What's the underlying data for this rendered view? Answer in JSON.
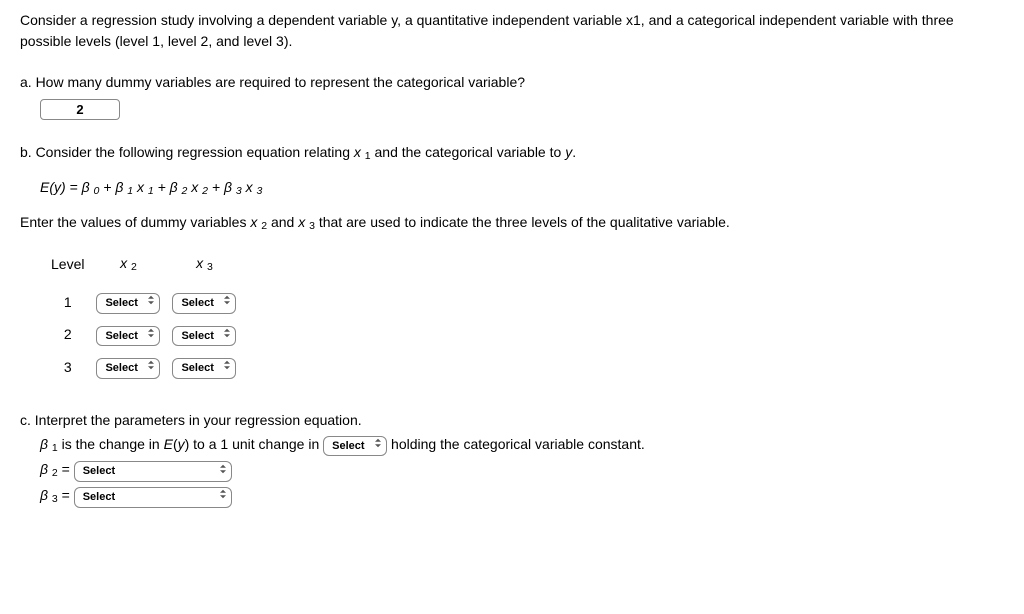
{
  "intro": "Consider a regression study involving a dependent variable y, a quantitative independent variable x1, and a categorical independent variable with three possible levels (level 1, level 2, and level 3).",
  "a": {
    "prompt": "a. How many dummy variables are required to represent the categorical variable?",
    "value": "2"
  },
  "b": {
    "prompt1": "b. Consider the following regression equation relating x ₁ and the categorical variable to y.",
    "equation": "E(y) = β ₀ + β ₁ x ₁ + β ₂ x ₂ + β ₃ x ₃",
    "prompt2": "Enter the values of dummy variables x ₂ and x ₃ that are used to indicate the three levels of the qualitative variable.",
    "headers": {
      "level": "Level",
      "x2": "x 2",
      "x3": "x 3"
    },
    "rows": [
      {
        "level": "1",
        "x2": "Select",
        "x3": "Select"
      },
      {
        "level": "2",
        "x2": "Select",
        "x3": "Select"
      },
      {
        "level": "3",
        "x2": "Select",
        "x3": "Select"
      }
    ]
  },
  "c": {
    "prompt": "c. Interpret the parameters in your regression equation.",
    "b1_pre": "β ₁ is the change in E(y) to a 1 unit change in",
    "b1_select": "Select",
    "b1_post": "holding the categorical variable constant.",
    "b2_label": "β ₂ =",
    "b2_select": "Select",
    "b3_label": "β ₃ =",
    "b3_select": "Select"
  }
}
